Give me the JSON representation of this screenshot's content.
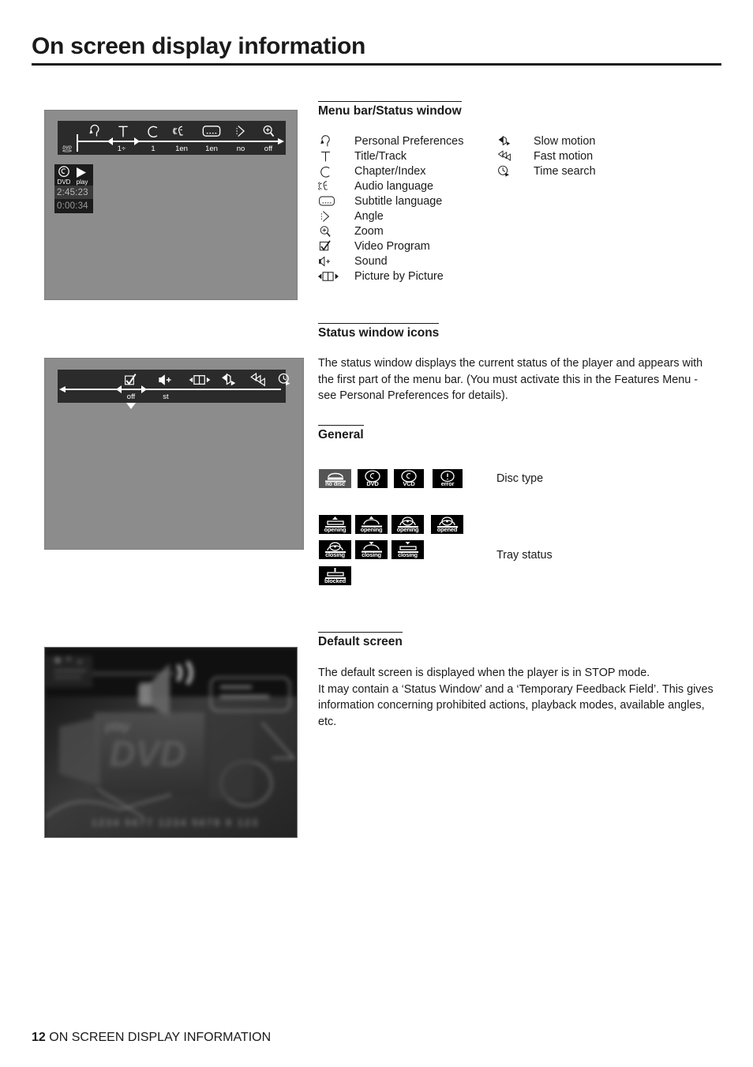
{
  "page": {
    "title": "On screen display information",
    "footer_number": "12",
    "footer_text": "ON SCREEN DISPLAY INFORMATION"
  },
  "sections": {
    "menu_bar": {
      "heading": "Menu bar/Status window"
    },
    "status_icons": {
      "heading": "Status window icons",
      "body": "The status window displays the current status of the player and appears with the first part of the menu bar. (You must activate this in the Features Menu - see Personal Preferences for details)."
    },
    "general": {
      "heading": "General"
    },
    "default_screen": {
      "heading": "Default screen",
      "body": "The default screen is displayed when the player is in STOP mode.\nIt may contain a ‘Status Window’ and a ‘Temporary Feedback Field’. This gives information concerning prohibited actions, playback modes, available angles, etc."
    }
  },
  "legend": {
    "left_column": [
      {
        "icon": "personal-preferences-icon",
        "label": "Personal Preferences"
      },
      {
        "icon": "title-track-icon",
        "label": "Title/Track"
      },
      {
        "icon": "chapter-index-icon",
        "label": "Chapter/Index"
      },
      {
        "icon": "audio-language-icon",
        "label": "Audio language"
      },
      {
        "icon": "subtitle-language-icon",
        "label": "Subtitle language"
      },
      {
        "icon": "angle-icon",
        "label": "Angle"
      },
      {
        "icon": "zoom-icon",
        "label": "Zoom"
      },
      {
        "icon": "video-program-icon",
        "label": "Video Program"
      },
      {
        "icon": "sound-icon",
        "label": "Sound"
      },
      {
        "icon": "picture-by-picture-icon",
        "label": "Picture by Picture"
      }
    ],
    "right_column": [
      {
        "icon": "slow-motion-icon",
        "label": "Slow motion"
      },
      {
        "icon": "fast-motion-icon",
        "label": "Fast motion"
      },
      {
        "icon": "time-search-icon",
        "label": "Time search"
      }
    ]
  },
  "screenshot_one": {
    "disc_logo": "DVD",
    "menu_values": [
      "1÷",
      "1",
      "1en",
      "1en",
      "no",
      "off"
    ],
    "menu_icons": [
      "personal-preferences-icon",
      "title-track-icon",
      "chapter-index-icon",
      "audio-language-icon",
      "subtitle-language-icon",
      "angle-icon",
      "zoom-icon"
    ],
    "status_window": {
      "disc_type": "DVD",
      "play_state": "play",
      "total_time": "2:45:23",
      "elapsed_time": "0:00:34"
    }
  },
  "screenshot_two": {
    "menu_icons": [
      "video-program-icon",
      "sound-icon",
      "picture-by-picture-icon",
      "slow-motion-icon",
      "fast-motion-icon",
      "time-search-icon"
    ],
    "menu_values": [
      "off",
      "st"
    ]
  },
  "general_icons": {
    "disc_type_label": "Disc type",
    "tray_status_label": "Tray status",
    "disc_types": [
      {
        "name": "no-disc-icon",
        "text": "no disc",
        "selected": true
      },
      {
        "name": "dvd-disc-icon",
        "text": "DVD",
        "selected": false
      },
      {
        "name": "vcd-disc-icon",
        "text": "VCD",
        "selected": false
      },
      {
        "name": "error-disc-icon",
        "text": "error",
        "selected": false
      }
    ],
    "tray_row_one": [
      {
        "name": "tray-opening-1-icon",
        "text": "opening",
        "art": "tray-flat-up"
      },
      {
        "name": "tray-opening-2-icon",
        "text": "opening",
        "art": "tray-arc-up"
      },
      {
        "name": "tray-opening-3-icon",
        "text": "opening",
        "art": "tray-disc"
      },
      {
        "name": "tray-opened-icon",
        "text": "opened",
        "art": "tray-disc"
      }
    ],
    "tray_row_two": [
      {
        "name": "tray-closing-1-icon",
        "text": "closing",
        "art": "tray-disc-down"
      },
      {
        "name": "tray-closing-2-icon",
        "text": "closing",
        "art": "tray-arc-down"
      },
      {
        "name": "tray-closing-3-icon",
        "text": "closing",
        "art": "tray-flat-down"
      }
    ],
    "tray_row_three": [
      {
        "name": "tray-blocked-icon",
        "text": "blocked",
        "art": "tray-blocked"
      }
    ]
  }
}
